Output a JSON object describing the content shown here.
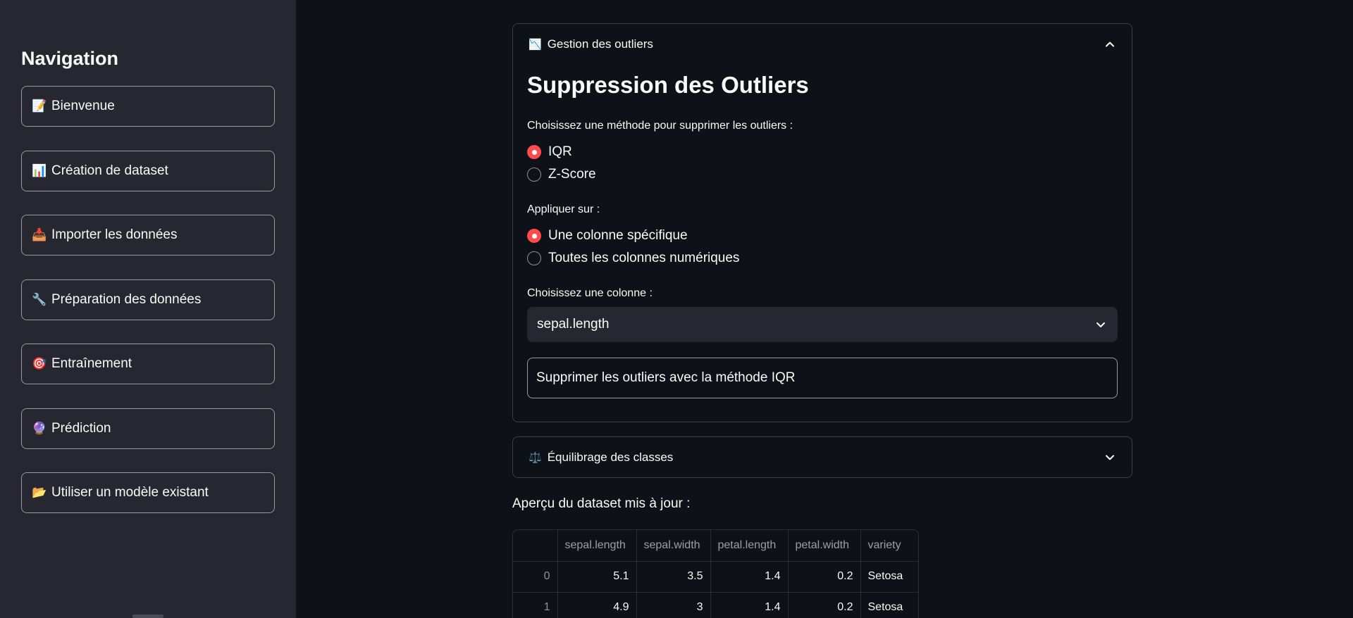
{
  "sidebar": {
    "title": "Navigation",
    "items": [
      {
        "icon": "📝",
        "icon_name": "memo-icon",
        "label": "Bienvenue"
      },
      {
        "icon": "📊",
        "icon_name": "bar-chart-icon",
        "label": "Création de dataset"
      },
      {
        "icon": "📥",
        "icon_name": "inbox-tray-icon",
        "label": "Importer les données"
      },
      {
        "icon": "🔧",
        "icon_name": "wrench-icon",
        "label": "Préparation des données"
      },
      {
        "icon": "🎯",
        "icon_name": "target-icon",
        "label": "Entraînement"
      },
      {
        "icon": "🔮",
        "icon_name": "crystal-ball-icon",
        "label": "Prédiction"
      },
      {
        "icon": "📂",
        "icon_name": "folder-icon",
        "label": "Utiliser un modèle existant"
      }
    ]
  },
  "outliers": {
    "icon": "📉",
    "header": "Gestion des outliers",
    "expanded": true,
    "title": "Suppression des Outliers",
    "method_label": "Choisissez une méthode pour supprimer les outliers :",
    "methods": [
      {
        "label": "IQR",
        "selected": true
      },
      {
        "label": "Z-Score",
        "selected": false
      }
    ],
    "apply_label": "Appliquer sur :",
    "apply_options": [
      {
        "label": "Une colonne spécifique",
        "selected": true
      },
      {
        "label": "Toutes les colonnes numériques",
        "selected": false
      }
    ],
    "column_label": "Choisissez une colonne :",
    "column_selected": "sepal.length",
    "button_label": "Supprimer les outliers avec la méthode IQR"
  },
  "balancing": {
    "icon": "⚖️",
    "header": "Équilibrage des classes",
    "expanded": false
  },
  "preview": {
    "label": "Aperçu du dataset mis à jour :",
    "columns": [
      "",
      "sepal.length",
      "sepal.width",
      "petal.length",
      "petal.width",
      "variety"
    ],
    "rows": [
      [
        "0",
        "5.1",
        "3.5",
        "1.4",
        "0.2",
        "Setosa"
      ],
      [
        "1",
        "4.9",
        "3",
        "1.4",
        "0.2",
        "Setosa"
      ]
    ]
  },
  "colors": {
    "background": "#0e1117",
    "sidebar": "#262730",
    "accent": "#ff4b4b",
    "text": "#fafafa"
  }
}
